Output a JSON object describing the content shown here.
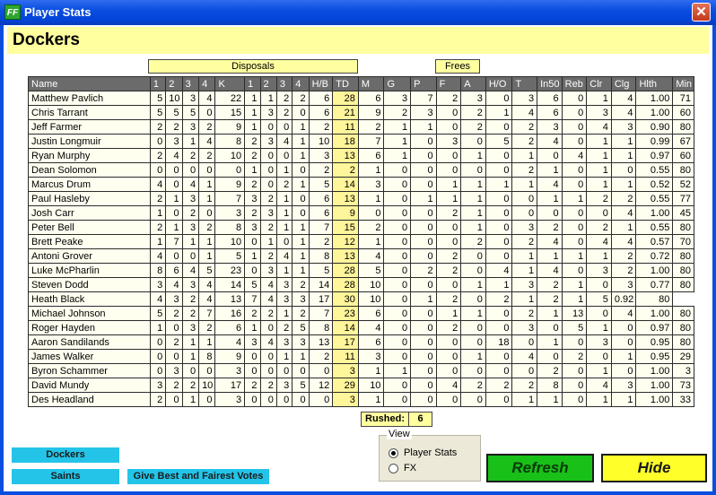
{
  "window": {
    "title": "Player Stats",
    "icon_text": "FF"
  },
  "team_name": "Dockers",
  "groups": {
    "disposals": "Disposals",
    "frees": "Frees"
  },
  "columns": [
    "Name",
    "1",
    "2",
    "3",
    "4",
    "K",
    "1",
    "2",
    "3",
    "4",
    "H/B",
    "TD",
    "M",
    "G",
    "P",
    "F",
    "A",
    "H/O",
    "T",
    "In50",
    "Reb",
    "Clr",
    "Clg",
    "Hlth",
    "Min"
  ],
  "players": [
    [
      "Matthew Pavlich",
      "5",
      "10",
      "3",
      "4",
      "22",
      "1",
      "1",
      "2",
      "2",
      "6",
      "28",
      "6",
      "3",
      "7",
      "2",
      "3",
      "0",
      "3",
      "6",
      "0",
      "1",
      "4",
      "1.00",
      "71"
    ],
    [
      "Chris Tarrant",
      "5",
      "5",
      "5",
      "0",
      "15",
      "1",
      "3",
      "2",
      "0",
      "6",
      "21",
      "9",
      "2",
      "3",
      "0",
      "2",
      "1",
      "4",
      "6",
      "0",
      "3",
      "4",
      "1.00",
      "60"
    ],
    [
      "Jeff Farmer",
      "2",
      "2",
      "3",
      "2",
      "9",
      "1",
      "0",
      "0",
      "1",
      "2",
      "11",
      "2",
      "1",
      "1",
      "0",
      "2",
      "0",
      "2",
      "3",
      "0",
      "4",
      "3",
      "0.90",
      "80"
    ],
    [
      "Justin Longmuir",
      "0",
      "3",
      "1",
      "4",
      "8",
      "2",
      "3",
      "4",
      "1",
      "10",
      "18",
      "7",
      "1",
      "0",
      "3",
      "0",
      "5",
      "2",
      "4",
      "0",
      "1",
      "1",
      "0.99",
      "67"
    ],
    [
      "Ryan Murphy",
      "2",
      "4",
      "2",
      "2",
      "10",
      "2",
      "0",
      "0",
      "1",
      "3",
      "13",
      "6",
      "1",
      "0",
      "0",
      "1",
      "0",
      "1",
      "0",
      "4",
      "1",
      "1",
      "0.97",
      "60"
    ],
    [
      "Dean Solomon",
      "0",
      "0",
      "0",
      "0",
      "0",
      "1",
      "0",
      "1",
      "0",
      "2",
      "2",
      "1",
      "0",
      "0",
      "0",
      "0",
      "0",
      "2",
      "1",
      "0",
      "1",
      "0",
      "0.55",
      "80"
    ],
    [
      "Marcus Drum",
      "4",
      "0",
      "4",
      "1",
      "9",
      "2",
      "0",
      "2",
      "1",
      "5",
      "14",
      "3",
      "0",
      "0",
      "1",
      "1",
      "1",
      "1",
      "4",
      "0",
      "1",
      "1",
      "0.52",
      "52"
    ],
    [
      "Paul Hasleby",
      "2",
      "1",
      "3",
      "1",
      "7",
      "3",
      "2",
      "1",
      "0",
      "6",
      "13",
      "1",
      "0",
      "1",
      "1",
      "1",
      "0",
      "0",
      "1",
      "1",
      "2",
      "2",
      "0.55",
      "77"
    ],
    [
      "Josh Carr",
      "1",
      "0",
      "2",
      "0",
      "3",
      "2",
      "3",
      "1",
      "0",
      "6",
      "9",
      "0",
      "0",
      "0",
      "2",
      "1",
      "0",
      "0",
      "0",
      "0",
      "0",
      "4",
      "1.00",
      "45"
    ],
    [
      "Peter Bell",
      "2",
      "1",
      "3",
      "2",
      "8",
      "3",
      "2",
      "1",
      "1",
      "7",
      "15",
      "2",
      "0",
      "0",
      "0",
      "1",
      "0",
      "3",
      "2",
      "0",
      "2",
      "1",
      "0.55",
      "80"
    ],
    [
      "Brett Peake",
      "1",
      "7",
      "1",
      "1",
      "10",
      "0",
      "1",
      "0",
      "1",
      "2",
      "12",
      "1",
      "0",
      "0",
      "0",
      "2",
      "0",
      "2",
      "4",
      "0",
      "4",
      "4",
      "0.57",
      "70"
    ],
    [
      "Antoni Grover",
      "4",
      "0",
      "0",
      "1",
      "5",
      "1",
      "2",
      "4",
      "1",
      "8",
      "13",
      "4",
      "0",
      "0",
      "2",
      "0",
      "0",
      "1",
      "1",
      "1",
      "1",
      "2",
      "0.72",
      "80"
    ],
    [
      "Luke McPharlin",
      "8",
      "6",
      "4",
      "5",
      "23",
      "0",
      "3",
      "1",
      "1",
      "5",
      "28",
      "5",
      "0",
      "2",
      "2",
      "0",
      "4",
      "1",
      "4",
      "0",
      "3",
      "2",
      "1.00",
      "80"
    ],
    [
      "Steven Dodd",
      "3",
      "4",
      "3",
      "4",
      "14",
      "5",
      "4",
      "3",
      "2",
      "14",
      "28",
      "10",
      "0",
      "0",
      "0",
      "1",
      "1",
      "3",
      "2",
      "1",
      "0",
      "3",
      "0.77",
      "80"
    ],
    [
      "Heath Black",
      "4",
      "3",
      "2",
      "4",
      "13",
      "7",
      "4",
      "3",
      "3",
      "17",
      "30",
      "10",
      "0",
      "1",
      "2",
      "0",
      "2",
      "1",
      "2",
      "1",
      "5",
      "0.92",
      "80"
    ],
    [
      "Michael Johnson",
      "5",
      "2",
      "2",
      "7",
      "16",
      "2",
      "2",
      "1",
      "2",
      "7",
      "23",
      "6",
      "0",
      "0",
      "1",
      "1",
      "0",
      "2",
      "1",
      "13",
      "0",
      "4",
      "1.00",
      "80"
    ],
    [
      "Roger Hayden",
      "1",
      "0",
      "3",
      "2",
      "6",
      "1",
      "0",
      "2",
      "5",
      "8",
      "14",
      "4",
      "0",
      "0",
      "2",
      "0",
      "0",
      "3",
      "0",
      "5",
      "1",
      "0",
      "0.97",
      "80"
    ],
    [
      "Aaron Sandilands",
      "0",
      "2",
      "1",
      "1",
      "4",
      "3",
      "4",
      "3",
      "3",
      "13",
      "17",
      "6",
      "0",
      "0",
      "0",
      "0",
      "18",
      "0",
      "1",
      "0",
      "3",
      "0",
      "0.95",
      "80"
    ],
    [
      "James Walker",
      "0",
      "0",
      "1",
      "8",
      "9",
      "0",
      "0",
      "1",
      "1",
      "2",
      "11",
      "3",
      "0",
      "0",
      "0",
      "1",
      "0",
      "4",
      "0",
      "2",
      "0",
      "1",
      "0.95",
      "29"
    ],
    [
      "Byron Schammer",
      "0",
      "3",
      "0",
      "0",
      "3",
      "0",
      "0",
      "0",
      "0",
      "0",
      "3",
      "1",
      "1",
      "0",
      "0",
      "0",
      "0",
      "0",
      "2",
      "0",
      "1",
      "0",
      "1.00",
      "3"
    ],
    [
      "David Mundy",
      "3",
      "2",
      "2",
      "10",
      "17",
      "2",
      "2",
      "3",
      "5",
      "12",
      "29",
      "10",
      "0",
      "0",
      "4",
      "2",
      "2",
      "2",
      "8",
      "0",
      "4",
      "3",
      "1.00",
      "73"
    ],
    [
      "Des Headland",
      "2",
      "0",
      "1",
      "0",
      "3",
      "0",
      "0",
      "0",
      "0",
      "0",
      "3",
      "1",
      "0",
      "0",
      "0",
      "0",
      "0",
      "1",
      "1",
      "0",
      "1",
      "1",
      "1.00",
      "33"
    ]
  ],
  "rushed": {
    "label": "Rushed:",
    "value": "6"
  },
  "team_buttons": {
    "home": "Dockers",
    "away": "Saints",
    "votes": "Give Best and Fairest Votes"
  },
  "view": {
    "legend": "View",
    "options": [
      "Player Stats",
      "FX"
    ],
    "selected": "Player Stats"
  },
  "actions": {
    "refresh": "Refresh",
    "hide": "Hide"
  },
  "colors": {
    "accent_yellow": "#ffffa0",
    "td_highlight": "#fff59a",
    "team_button": "#24c4e8",
    "refresh_green": "#18c018",
    "hide_yellow": "#ffff2a"
  }
}
